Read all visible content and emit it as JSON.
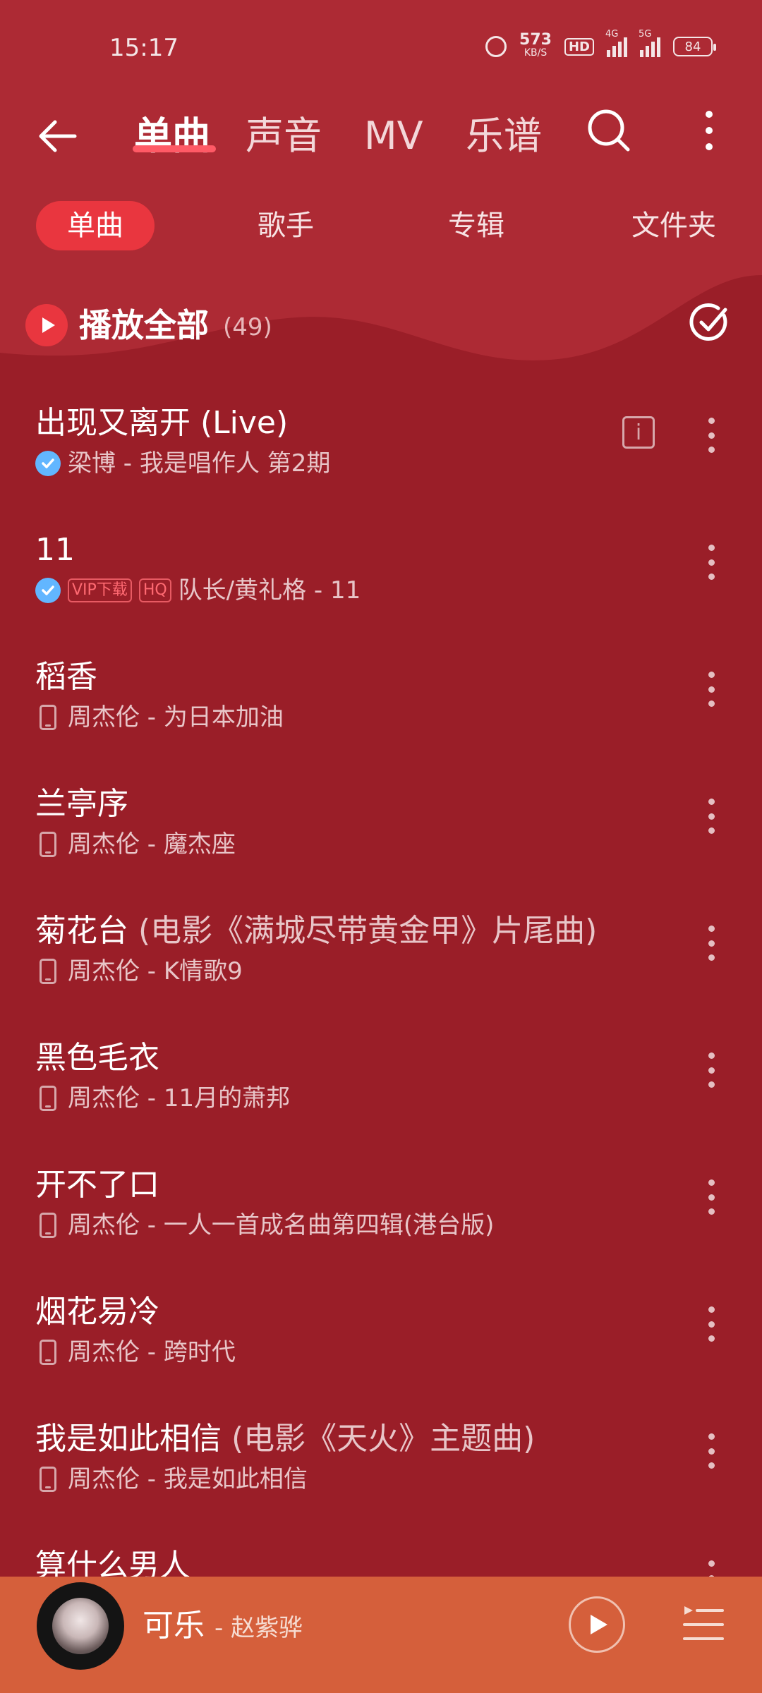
{
  "status_bar": {
    "time": "15:17",
    "net_speed": "573",
    "net_unit": "KB/S",
    "hd": "HD",
    "net1": "4G",
    "net2": "5G",
    "battery": "84"
  },
  "top_tabs": [
    "单曲",
    "声音",
    "MV",
    "乐谱"
  ],
  "active_tab": "单曲",
  "sub_tabs": [
    "单曲",
    "歌手",
    "专辑",
    "文件夹"
  ],
  "play_all": {
    "label": "播放全部",
    "count": "(49)"
  },
  "songs": [
    {
      "title": "出现又离开 (Live)",
      "extra": "",
      "subtitle": "梁博 - 我是唱作人 第2期",
      "icon": "check-icon",
      "badges": [],
      "info": true
    },
    {
      "title": "11",
      "extra": "",
      "subtitle": "队长/黄礼格 - 11",
      "icon": "check-icon",
      "badges": [
        "VIP下载",
        "HQ"
      ],
      "info": false
    },
    {
      "title": "稻香",
      "extra": "",
      "subtitle": "周杰伦 - 为日本加油",
      "icon": "phone-icon",
      "badges": [],
      "info": false
    },
    {
      "title": "兰亭序",
      "extra": "",
      "subtitle": "周杰伦 - 魔杰座",
      "icon": "phone-icon",
      "badges": [],
      "info": false
    },
    {
      "title": "菊花台",
      "extra": "(电影《满城尽带黄金甲》片尾曲)",
      "subtitle": "周杰伦 - K情歌9",
      "icon": "phone-icon",
      "badges": [],
      "info": false
    },
    {
      "title": "黑色毛衣",
      "extra": "",
      "subtitle": "周杰伦 - 11月的萧邦",
      "icon": "phone-icon",
      "badges": [],
      "info": false
    },
    {
      "title": "开不了口",
      "extra": "",
      "subtitle": "周杰伦 - 一人一首成名曲第四辑(港台版)",
      "icon": "phone-icon",
      "badges": [],
      "info": false
    },
    {
      "title": "烟花易冷",
      "extra": "",
      "subtitle": "周杰伦 - 跨时代",
      "icon": "phone-icon",
      "badges": [],
      "info": false
    },
    {
      "title": "我是如此相信",
      "extra": "(电影《天火》主题曲)",
      "subtitle": "周杰伦 - 我是如此相信",
      "icon": "phone-icon",
      "badges": [],
      "info": false
    },
    {
      "title": "算什么男人",
      "extra": "",
      "subtitle": "",
      "icon": "phone-icon",
      "badges": [],
      "info": false
    }
  ],
  "player": {
    "title": "可乐",
    "artist": "- 赵紫骅"
  },
  "colors": {
    "background": "#9a1e28",
    "header": "#ad2a34",
    "accent": "#e9363f",
    "player_bar": "#d55f3b"
  }
}
